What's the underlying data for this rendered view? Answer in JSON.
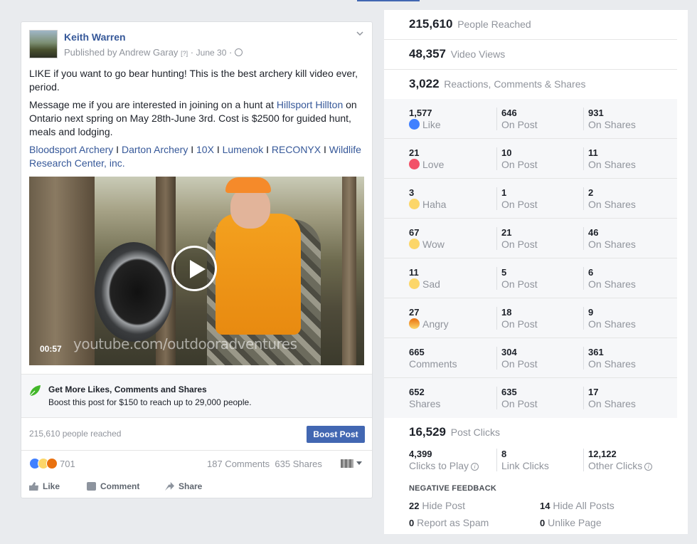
{
  "post": {
    "author": "Keith Warren",
    "published_by": "Published by Andrew Garay",
    "help_mark": "[?]",
    "separator": "·",
    "date": "June 30",
    "text_line1": "LIKE if you want to go bear hunting! This is the best archery kill video ever, period.",
    "text_msg_before": "Message me if you are interested in joining on a hunt at ",
    "text_msg_link": "Hillsport Hillton",
    "text_msg_after": " on Ontario next spring on May 28th-June 3rd. Cost is $2500 for guided hunt, meals and lodging.",
    "tags": [
      "Bloodsport Archery",
      "Darton Archery",
      "10X",
      "Lumenok",
      "RECONYX",
      "Wildlife Research Center, inc."
    ],
    "tag_separator": " I ",
    "video": {
      "duration": "00:57",
      "watermark": "youtube.com/outdooradventures"
    },
    "boost": {
      "title": "Get More Likes, Comments and Shares",
      "subtitle": "Boost this post for $150 to reach up to 29,000 people.",
      "button": "Boost Post"
    },
    "reached_text": "215,610 people reached",
    "reaction_count": "701",
    "comments": "187 Comments",
    "shares": "635 Shares",
    "actions": {
      "like": "Like",
      "comment": "Comment",
      "share": "Share"
    }
  },
  "insights": {
    "people_reached": {
      "value": "215,610",
      "label": "People Reached"
    },
    "video_views": {
      "value": "48,357",
      "label": "Video Views"
    },
    "engagement": {
      "value": "3,022",
      "label": "Reactions, Comments & Shares"
    },
    "rows": [
      {
        "total": "1,577",
        "label": "Like",
        "icon": "like-icon",
        "on_post": "646",
        "on_shares": "931"
      },
      {
        "total": "21",
        "label": "Love",
        "icon": "love-icon",
        "on_post": "10",
        "on_shares": "11"
      },
      {
        "total": "3",
        "label": "Haha",
        "icon": "haha-icon",
        "on_post": "1",
        "on_shares": "2"
      },
      {
        "total": "67",
        "label": "Wow",
        "icon": "wow-icon",
        "on_post": "21",
        "on_shares": "46"
      },
      {
        "total": "11",
        "label": "Sad",
        "icon": "sad-icon",
        "on_post": "5",
        "on_shares": "6"
      },
      {
        "total": "27",
        "label": "Angry",
        "icon": "angry-icon",
        "on_post": "18",
        "on_shares": "9"
      },
      {
        "total": "665",
        "label": "Comments",
        "icon": "",
        "on_post": "304",
        "on_shares": "361"
      },
      {
        "total": "652",
        "label": "Shares",
        "icon": "",
        "on_post": "635",
        "on_shares": "17"
      }
    ],
    "on_post_label": "On Post",
    "on_shares_label": "On Shares",
    "post_clicks": {
      "value": "16,529",
      "label": "Post Clicks"
    },
    "clicks": [
      {
        "value": "4,399",
        "label": "Clicks to Play",
        "info": true
      },
      {
        "value": "8",
        "label": "Link Clicks",
        "info": false
      },
      {
        "value": "12,122",
        "label": "Other Clicks",
        "info": true
      }
    ],
    "negative": {
      "title": "NEGATIVE FEEDBACK",
      "hide_post": {
        "value": "22",
        "label": "Hide Post"
      },
      "hide_all": {
        "value": "14",
        "label": "Hide All Posts"
      },
      "spam": {
        "value": "0",
        "label": "Report as Spam"
      },
      "unlike": {
        "value": "0",
        "label": "Unlike Page"
      }
    }
  },
  "colors": {
    "link": "#365899",
    "button": "#4267b2",
    "muted": "#90949c",
    "panel_bg": "#f6f7f9"
  }
}
